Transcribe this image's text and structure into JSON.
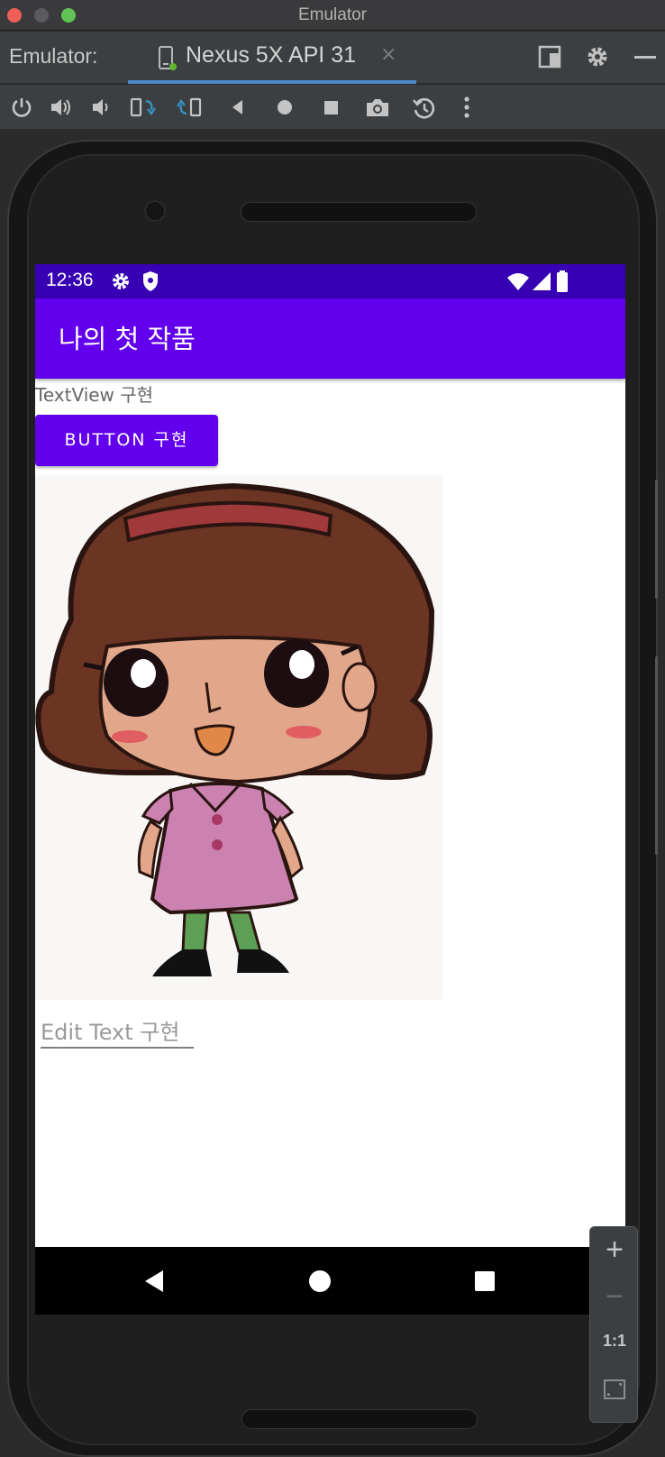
{
  "window": {
    "title": "Emulator"
  },
  "tool_window": {
    "label": "Emulator:",
    "tab_label": "Nexus 5X API 31",
    "tab_close": "×"
  },
  "toolbar": {
    "icons": [
      "power-icon",
      "volume-up-icon",
      "volume-down-icon",
      "rotate-left-icon",
      "rotate-right-icon",
      "back-icon",
      "home-icon",
      "overview-icon",
      "screenshot-icon",
      "snapshot-icon",
      "more-icon"
    ]
  },
  "device": {
    "status_time": "12:36",
    "app_title": "나의 첫 작품",
    "textview": "TextView 구현",
    "button_label": "BUTTON 구현",
    "edittext_hint": "Edit Text 구현",
    "colors": {
      "status_bar": "#3700b3",
      "app_bar": "#6200ee",
      "button": "#6200ee"
    }
  },
  "zoom": {
    "plus": "+",
    "minus": "−",
    "one_to_one": "1:1"
  }
}
